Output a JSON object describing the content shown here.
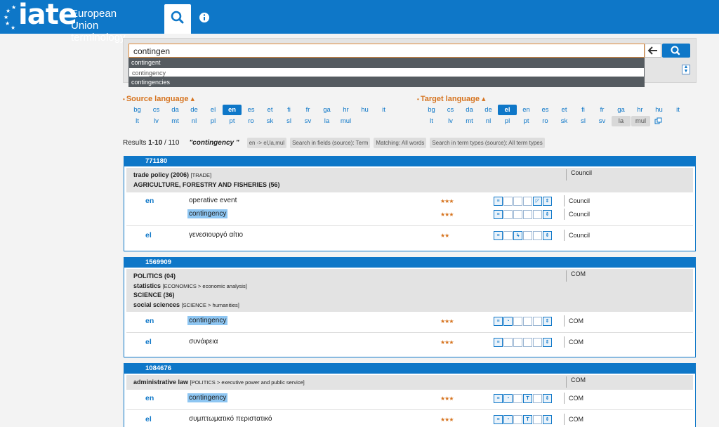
{
  "header": {
    "logo_text": "iate",
    "logo_sub1": "European Union",
    "logo_sub2": "terminology"
  },
  "search": {
    "value": "contingen",
    "suggestions": [
      "contingent",
      "contingency",
      "contingencies"
    ]
  },
  "source_language": {
    "label": "Source language",
    "row1": [
      "bg",
      "cs",
      "da",
      "de",
      "el",
      "en",
      "es",
      "et",
      "fi",
      "fr",
      "ga",
      "hr",
      "hu",
      "it"
    ],
    "row2": [
      "lt",
      "lv",
      "mt",
      "nl",
      "pl",
      "pt",
      "ro",
      "sk",
      "sl",
      "sv",
      "la",
      "mul"
    ],
    "selected": "en"
  },
  "target_language": {
    "label": "Target language",
    "row1": [
      "bg",
      "cs",
      "da",
      "de",
      "el",
      "en",
      "es",
      "et",
      "fi",
      "fr",
      "ga",
      "hr",
      "hu",
      "it"
    ],
    "row2": [
      "lt",
      "lv",
      "mt",
      "nl",
      "pl",
      "pt",
      "ro",
      "sk",
      "sl",
      "sv",
      "la",
      "mul"
    ],
    "selected": "el",
    "greyed": [
      "la",
      "mul"
    ]
  },
  "results": {
    "label": "Results",
    "range": "1-10",
    "total": "/ 110",
    "query": "\"contingency \"",
    "chips": [
      "en -> el,la,mul",
      "Search in fields (source): Term",
      "Matching: All words",
      "Search in term types (source): All term types"
    ]
  },
  "entries": [
    {
      "id": "771180",
      "domain_source": "Council",
      "domains": [
        {
          "label": "trade policy (2006)",
          "sub": "[TRADE]"
        },
        {
          "label": "AGRICULTURE, FORESTRY AND FISHERIES (56)",
          "sub": ""
        }
      ],
      "rows": [
        {
          "lang": "en",
          "term": "operative event",
          "stars": "★★★",
          "src": "Council"
        },
        {
          "lang": "",
          "term": "contingency",
          "stars": "★★★",
          "src": "Council"
        },
        {
          "lang": "el",
          "term": "γενεσιουργό αίτιο",
          "stars": "★★",
          "src": "Council"
        }
      ]
    },
    {
      "id": "1569909",
      "domain_source": "COM",
      "domains": [
        {
          "label": "POLITICS (04)",
          "sub": ""
        },
        {
          "label": "statistics",
          "sub": "[ECONOMICS > economic analysis]"
        },
        {
          "label": "SCIENCE (36)",
          "sub": ""
        },
        {
          "label": "social sciences",
          "sub": "[SCIENCE > humanities]"
        }
      ],
      "rows": [
        {
          "lang": "en",
          "term": "contingency",
          "stars": "★★★",
          "src": "COM"
        },
        {
          "lang": "el",
          "term": "συνάφεια",
          "stars": "★★★",
          "src": "COM"
        }
      ]
    },
    {
      "id": "1084676",
      "domain_source": "COM",
      "domains": [
        {
          "label": "administrative law",
          "sub": "[POLITICS > executive power and public service]"
        }
      ],
      "rows": [
        {
          "lang": "en",
          "term": "contingency",
          "stars": "★★★",
          "src": "COM"
        },
        {
          "lang": "el",
          "term": "συμπτωματικό περιστατικό",
          "stars": "★★★",
          "src": "COM"
        }
      ]
    }
  ]
}
